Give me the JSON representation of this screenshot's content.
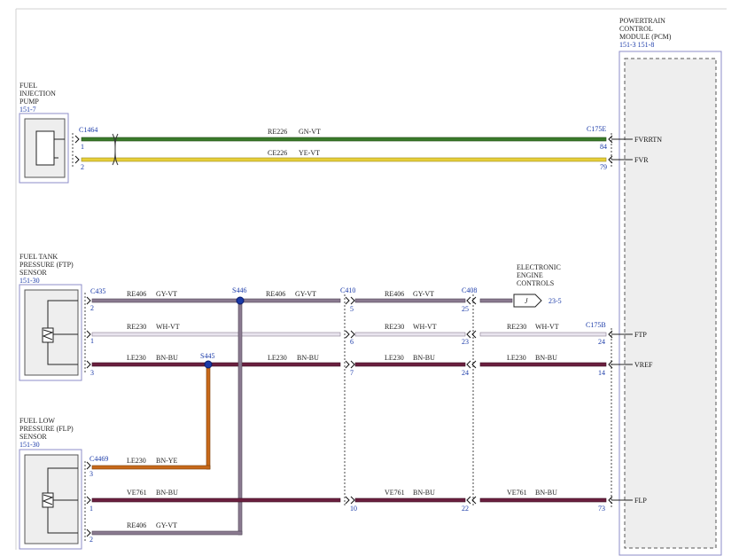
{
  "components": {
    "fuel_injection_pump": {
      "name_lines": [
        "FUEL",
        "INJECTION",
        "PUMP"
      ],
      "ref": "151-7"
    },
    "ftp_sensor": {
      "name_lines": [
        "FUEL TANK",
        "PRESSURE (FTP)",
        "SENSOR"
      ],
      "ref": "151-30"
    },
    "flp_sensor": {
      "name_lines": [
        "FUEL LOW",
        "PRESSURE (FLP)",
        "SENSOR"
      ],
      "ref": "151-30"
    },
    "pcm": {
      "name_lines": [
        "POWERTRAIN",
        "CONTROL",
        "MODULE (PCM)"
      ],
      "ref": "151-3   151-8"
    },
    "eec": {
      "name_lines": [
        "ELECTRONIC",
        "ENGINE",
        "CONTROLS"
      ],
      "ref_label": "J",
      "ref": "23-5"
    }
  },
  "connectors": {
    "c1464": "C1464",
    "c175e": "C175E",
    "c435": "C435",
    "s446": "S446",
    "c410": "C410",
    "c408": "C408",
    "c175b": "C175B",
    "s445": "S445",
    "c4469": "C4469"
  },
  "pins": {
    "fip_1": "1",
    "fip_2": "2",
    "pcm_84": "84",
    "pcm_79": "79",
    "ftp_2": "2",
    "ftp_1": "1",
    "ftp_3": "3",
    "c410_5": "5",
    "c410_6": "6",
    "c410_7": "7",
    "c410_10": "10",
    "c408_25": "25",
    "c408_23": "23",
    "c408_24": "24",
    "c408_22": "22",
    "pcm_24": "24",
    "pcm_14": "14",
    "pcm_73": "73",
    "flp_3": "3",
    "flp_1": "1",
    "flp_2": "2"
  },
  "pcm_signals": {
    "fvrrtn": "FVRRTN",
    "fvr": "FVR",
    "ftp": "FTP",
    "vref": "VREF",
    "flp": "FLP"
  },
  "wires": {
    "w1": {
      "circuit": "RE226",
      "color": "GN-VT",
      "hex": "#3a7a2a"
    },
    "w2": {
      "circuit": "CE226",
      "color": "YE-VT",
      "hex": "#e6cf3a"
    },
    "re406_a": {
      "circuit": "RE406",
      "color": "GY-VT"
    },
    "re406_b": {
      "circuit": "RE406",
      "color": "GY-VT"
    },
    "re406_c": {
      "circuit": "RE406",
      "color": "GY-VT"
    },
    "re406_d": {
      "circuit": "RE406",
      "color": "GY-VT"
    },
    "re230_a": {
      "circuit": "RE230",
      "color": "WH-VT"
    },
    "re230_b": {
      "circuit": "RE230",
      "color": "WH-VT"
    },
    "re230_c": {
      "circuit": "RE230",
      "color": "WH-VT"
    },
    "le230_a": {
      "circuit": "LE230",
      "color": "BN-BU"
    },
    "le230_b": {
      "circuit": "LE230",
      "color": "BN-BU"
    },
    "le230_c": {
      "circuit": "LE230",
      "color": "BN-BU"
    },
    "le230_d": {
      "circuit": "LE230",
      "color": "BN-BU"
    },
    "le230_ye": {
      "circuit": "LE230",
      "color": "BN-YE"
    },
    "ve761_a": {
      "circuit": "VE761",
      "color": "BN-BU"
    },
    "ve761_b": {
      "circuit": "VE761",
      "color": "BN-BU"
    },
    "ve761_c": {
      "circuit": "VE761",
      "color": "BN-BU"
    }
  },
  "colors": {
    "gy_vt": "#8a7a90",
    "wh_vt": "#e9e4ee",
    "bn_bu": "#6b1f3f",
    "bn_ye": "#c8691a",
    "component_fill": "#eeeeee",
    "component_border": "#8e8ec8",
    "label_blue": "#1a3aa8"
  }
}
